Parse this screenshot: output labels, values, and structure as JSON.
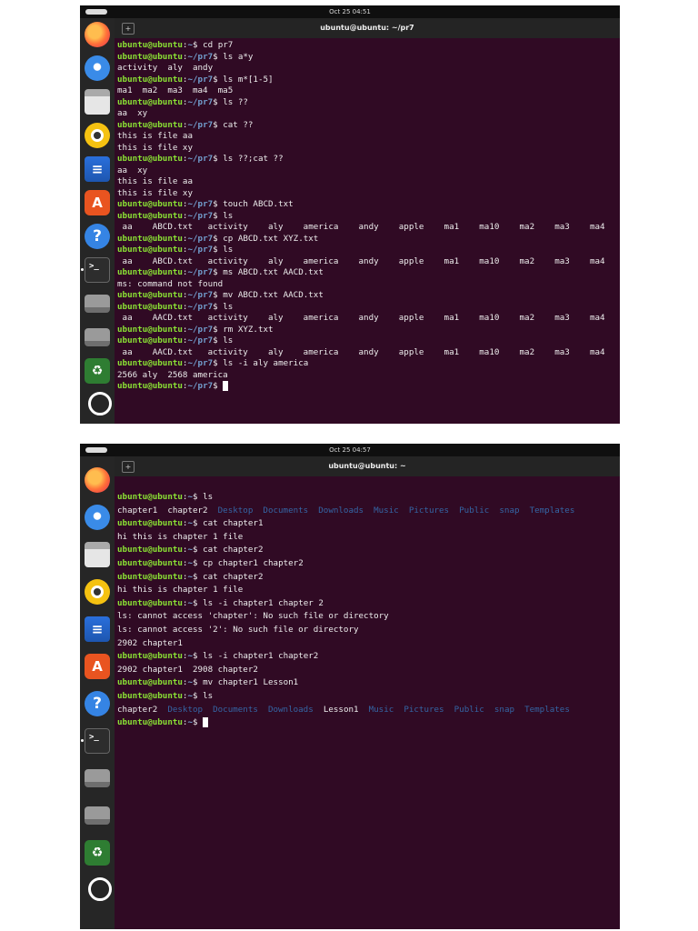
{
  "screens": [
    {
      "clock": "Oct 25 04:51",
      "title": "ubuntu@ubuntu: ~/pr7",
      "lines": [
        {
          "host": "ubuntu@ubuntu",
          "path": "~",
          "cmd": " cd pr7"
        },
        {
          "host": "ubuntu@ubuntu",
          "path": "~/pr7",
          "cmd": " ls a*y"
        },
        {
          "out": "activity  aly  andy"
        },
        {
          "host": "ubuntu@ubuntu",
          "path": "~/pr7",
          "cmd": " ls m*[1-5]"
        },
        {
          "out": "ma1  ma2  ma3  ma4  ma5"
        },
        {
          "host": "ubuntu@ubuntu",
          "path": "~/pr7",
          "cmd": " ls ??"
        },
        {
          "out": "aa  xy"
        },
        {
          "host": "ubuntu@ubuntu",
          "path": "~/pr7",
          "cmd": " cat ??"
        },
        {
          "out": "this is file aa"
        },
        {
          "out": "this is file xy"
        },
        {
          "host": "ubuntu@ubuntu",
          "path": "~/pr7",
          "cmd": " ls ??;cat ??"
        },
        {
          "out": "aa  xy"
        },
        {
          "out": "this is file aa"
        },
        {
          "out": "this is file xy"
        },
        {
          "host": "ubuntu@ubuntu",
          "path": "~/pr7",
          "cmd": " touch ABCD.txt"
        },
        {
          "host": "ubuntu@ubuntu",
          "path": "~/pr7",
          "cmd": " ls"
        },
        {
          "out": " aa    ABCD.txt   activity    aly    america    andy    apple    ma1    ma10    ma2    ma3    ma4"
        },
        {
          "host": "ubuntu@ubuntu",
          "path": "~/pr7",
          "cmd": " cp ABCD.txt XYZ.txt"
        },
        {
          "host": "ubuntu@ubuntu",
          "path": "~/pr7",
          "cmd": " ls"
        },
        {
          "out": " aa    ABCD.txt   activity    aly    america    andy    apple    ma1    ma10    ma2    ma3    ma4"
        },
        {
          "host": "ubuntu@ubuntu",
          "path": "~/pr7",
          "cmd": " ms ABCD.txt AACD.txt"
        },
        {
          "out": "ms: command not found"
        },
        {
          "host": "ubuntu@ubuntu",
          "path": "~/pr7",
          "cmd": " mv ABCD.txt AACD.txt"
        },
        {
          "host": "ubuntu@ubuntu",
          "path": "~/pr7",
          "cmd": " ls"
        },
        {
          "out": " aa    AACD.txt   activity    aly    america    andy    apple    ma1    ma10    ma2    ma3    ma4"
        },
        {
          "host": "ubuntu@ubuntu",
          "path": "~/pr7",
          "cmd": " rm XYZ.txt"
        },
        {
          "host": "ubuntu@ubuntu",
          "path": "~/pr7",
          "cmd": " ls"
        },
        {
          "out": " aa    AACD.txt   activity    aly    america    andy    apple    ma1    ma10    ma2    ma3    ma4"
        },
        {
          "host": "ubuntu@ubuntu",
          "path": "~/pr7",
          "cmd": " ls -i aly america"
        },
        {
          "out": "2566 aly  2568 america"
        },
        {
          "host": "ubuntu@ubuntu",
          "path": "~/pr7",
          "cmd": " ",
          "cursor": true
        }
      ]
    },
    {
      "clock": "Oct 25 04:57",
      "title": "ubuntu@ubuntu: ~",
      "lines": [
        {
          "host": "ubuntu@ubuntu",
          "path": "~",
          "cmd": " ls"
        },
        {
          "seq": [
            {
              "t": "chapter1  chapter2  "
            },
            {
              "t": "Desktop  Documents  Downloads  Music  Pictures  Public  snap  Templates",
              "dir": true
            }
          ]
        },
        {
          "host": "ubuntu@ubuntu",
          "path": "~",
          "cmd": " cat chapter1"
        },
        {
          "out": "hi this is chapter 1 file"
        },
        {
          "host": "ubuntu@ubuntu",
          "path": "~",
          "cmd": " cat chapter2"
        },
        {
          "host": "ubuntu@ubuntu",
          "path": "~",
          "cmd": " cp chapter1 chapter2"
        },
        {
          "host": "ubuntu@ubuntu",
          "path": "~",
          "cmd": " cat chapter2"
        },
        {
          "out": "hi this is chapter 1 file"
        },
        {
          "host": "ubuntu@ubuntu",
          "path": "~",
          "cmd": " ls -i chapter1 chapter 2"
        },
        {
          "out": "ls: cannot access 'chapter': No such file or directory"
        },
        {
          "out": "ls: cannot access '2': No such file or directory"
        },
        {
          "out": "2902 chapter1"
        },
        {
          "host": "ubuntu@ubuntu",
          "path": "~",
          "cmd": " ls -i chapter1 chapter2"
        },
        {
          "out": "2902 chapter1  2908 chapter2"
        },
        {
          "host": "ubuntu@ubuntu",
          "path": "~",
          "cmd": " mv chapter1 Lesson1"
        },
        {
          "host": "ubuntu@ubuntu",
          "path": "~",
          "cmd": " ls"
        },
        {
          "seq": [
            {
              "t": "chapter2  "
            },
            {
              "t": "Desktop  Documents  Downloads  ",
              "dir": true
            },
            {
              "t": "Lesson1  "
            },
            {
              "t": "Music  Pictures  Public  snap  Templates",
              "dir": true
            }
          ]
        },
        {
          "host": "ubuntu@ubuntu",
          "path": "~",
          "cmd": " ",
          "cursor": true
        }
      ]
    }
  ],
  "dock": [
    "firefox-icon",
    "thunderbird-icon",
    "files-icon",
    "rhythmbox-icon",
    "writer-icon",
    "app-center-icon",
    "help-icon",
    "terminal-icon",
    "drive-icon",
    "drive-icon",
    "trash-icon",
    "show-apps-icon"
  ],
  "colors": {
    "terminal_bg": "#300a24",
    "prompt_user": "#8ae234",
    "prompt_path": "#729fcf",
    "directory": "#3465a4"
  }
}
